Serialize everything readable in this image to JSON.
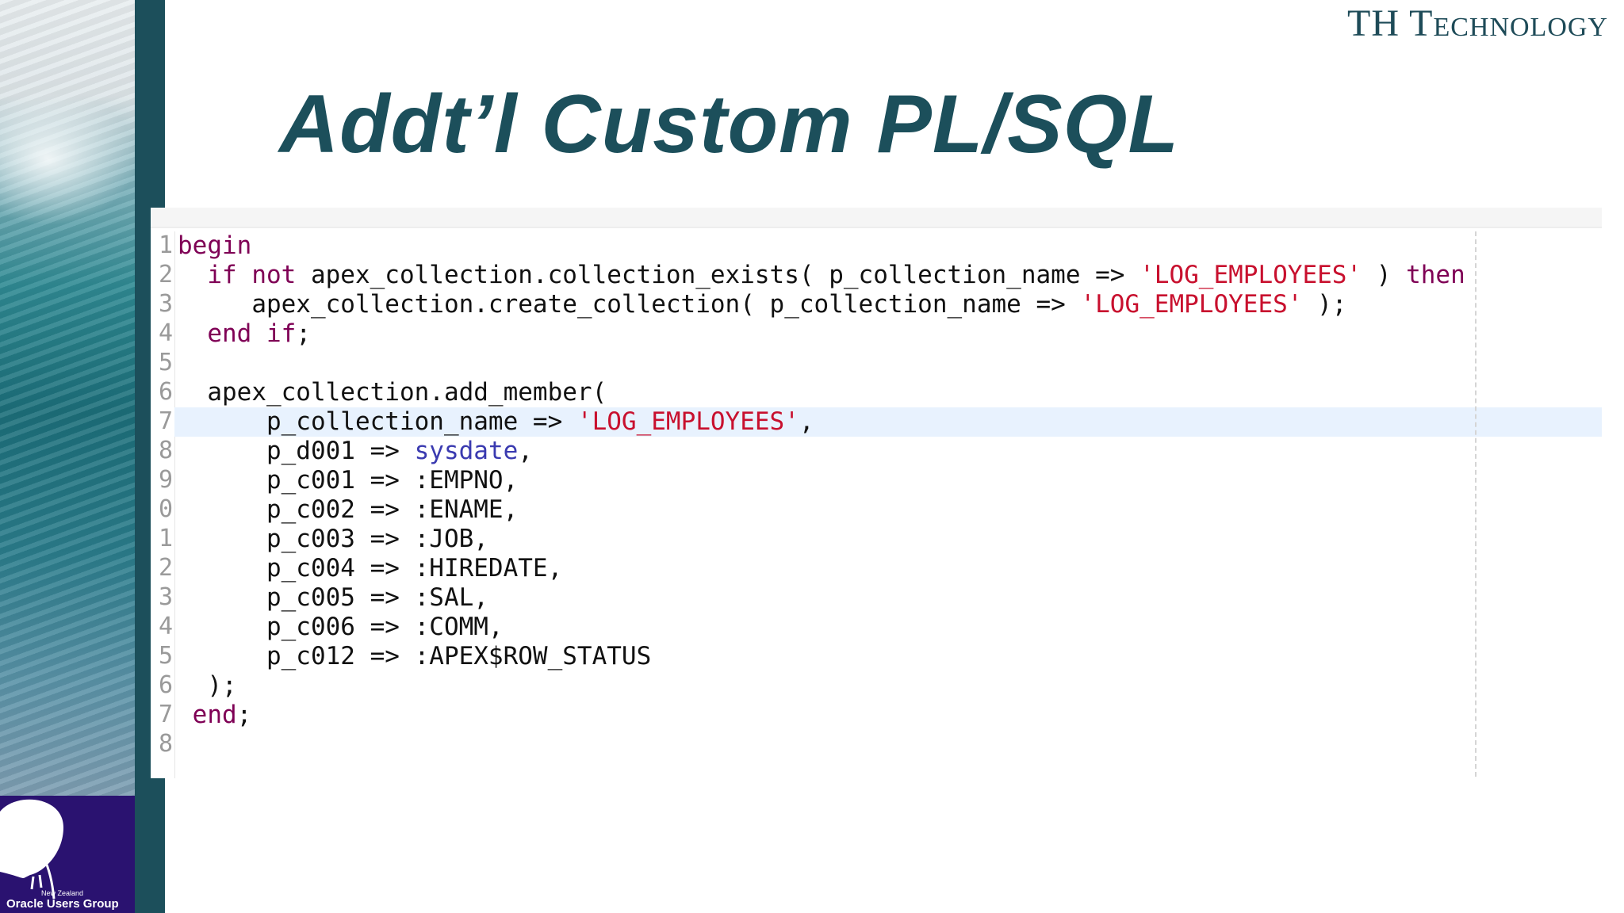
{
  "brand": {
    "text": "TH Technology"
  },
  "slide": {
    "title": "Addt’l Custom PL/SQL"
  },
  "logo": {
    "small_text": "New Zealand",
    "main_text": "Oracle Users Group"
  },
  "editor": {
    "line_numbers": [
      "1",
      "2",
      "3",
      "4",
      "5",
      "6",
      "7",
      "8",
      "9",
      "0",
      "1",
      "2",
      "3",
      "4",
      "5",
      "6",
      "7",
      "8"
    ],
    "lines": [
      [
        {
          "t": "kw",
          "v": "begin"
        }
      ],
      [
        {
          "t": "pl",
          "v": "  "
        },
        {
          "t": "kw",
          "v": "if not"
        },
        {
          "t": "pl",
          "v": " apex_collection.collection_exists( p_collection_name => "
        },
        {
          "t": "str",
          "v": "'LOG_EMPLOYEES'"
        },
        {
          "t": "pl",
          "v": " ) "
        },
        {
          "t": "kw",
          "v": "then"
        }
      ],
      [
        {
          "t": "pl",
          "v": "     apex_collection.create_collection( p_collection_name => "
        },
        {
          "t": "str",
          "v": "'LOG_EMPLOYEES'"
        },
        {
          "t": "pl",
          "v": " );"
        }
      ],
      [
        {
          "t": "pl",
          "v": "  "
        },
        {
          "t": "kw",
          "v": "end if"
        },
        {
          "t": "pl",
          "v": ";"
        }
      ],
      [
        {
          "t": "pl",
          "v": ""
        }
      ],
      [
        {
          "t": "pl",
          "v": "  apex_collection.add_member("
        }
      ],
      [
        {
          "t": "pl",
          "v": "      p_collection_name => "
        },
        {
          "t": "str",
          "v": "'LOG_EMPLOYEES'"
        },
        {
          "t": "pl",
          "v": ","
        }
      ],
      [
        {
          "t": "pl",
          "v": "      p_d001 => "
        },
        {
          "t": "fn",
          "v": "sysdate"
        },
        {
          "t": "pl",
          "v": ","
        }
      ],
      [
        {
          "t": "pl",
          "v": "      p_c001 => :EMPNO,"
        }
      ],
      [
        {
          "t": "pl",
          "v": "      p_c002 => :ENAME,"
        }
      ],
      [
        {
          "t": "pl",
          "v": "      p_c003 => :JOB,"
        }
      ],
      [
        {
          "t": "pl",
          "v": "      p_c004 => :HIREDATE,"
        }
      ],
      [
        {
          "t": "pl",
          "v": "      p_c005 => :SAL,"
        }
      ],
      [
        {
          "t": "pl",
          "v": "      p_c006 => :COMM,"
        }
      ],
      [
        {
          "t": "pl",
          "v": "      p_c012 => :APEX$ROW_STATUS"
        }
      ],
      [
        {
          "t": "pl",
          "v": "  );"
        }
      ],
      [
        {
          "t": "pl",
          "v": " "
        },
        {
          "t": "kw",
          "v": "end"
        },
        {
          "t": "pl",
          "v": ";"
        }
      ],
      [
        {
          "t": "pl",
          "v": ""
        }
      ]
    ],
    "highlighted_line": 7
  },
  "colors": {
    "accent_dark_teal": "#1c4f5b",
    "logo_purple": "#2a1270",
    "keyword": "#7f0055",
    "string": "#c8102e",
    "function": "#3a3ab0",
    "current_line_highlight": "#e8f2fe"
  }
}
